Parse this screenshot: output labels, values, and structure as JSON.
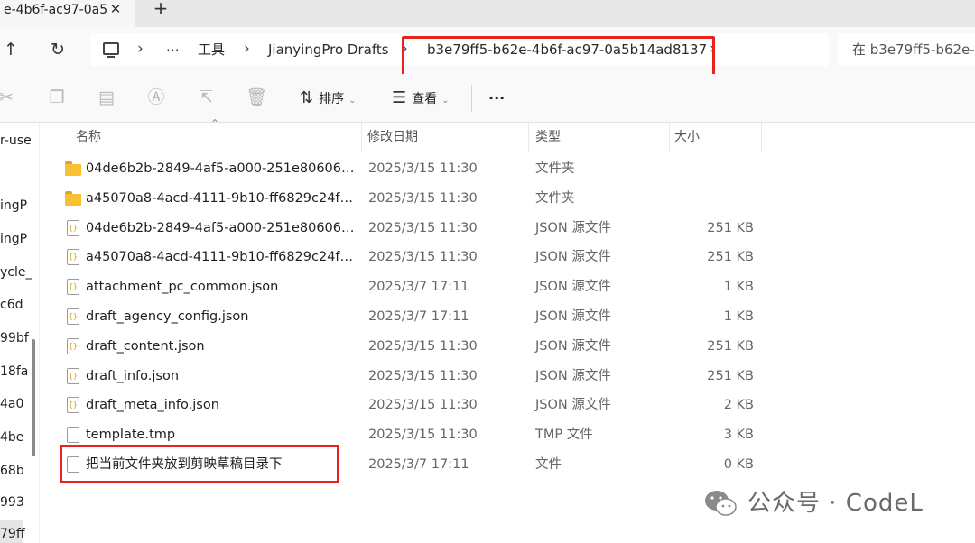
{
  "tab": {
    "title": "e-4b6f-ac97-0a5",
    "close": "✕",
    "new": "+"
  },
  "address": {
    "crumbs": [
      "工具",
      "JianyingPro Drafts",
      "b3e79ff5-b62e-4b6f-ac97-0a5b14ad8137"
    ],
    "overflow": "⋯",
    "search_placeholder": "在 b3e79ff5-b62e-4b6f-ac97-0a5b14ad8137 中搜索"
  },
  "toolbar": {
    "sort_label": "排序",
    "view_label": "查看",
    "more": "···"
  },
  "sidebar": {
    "items": [
      "r-use",
      "ingP",
      "ingP",
      "ycle_",
      "c6d",
      "99bf",
      "18fa",
      "4a0",
      "4be",
      "68b",
      "993",
      "79ff"
    ]
  },
  "columns": {
    "name": "名称",
    "date": "修改日期",
    "type": "类型",
    "size": "大小"
  },
  "files": [
    {
      "kind": "folder",
      "name": "04de6b2b-2849-4af5-a000-251e80606e6c",
      "date": "2025/3/15 11:30",
      "type": "文件夹",
      "size": ""
    },
    {
      "kind": "folder",
      "name": "a45070a8-4acd-4111-9b10-ff6829c24f4b",
      "date": "2025/3/15 11:30",
      "type": "文件夹",
      "size": ""
    },
    {
      "kind": "json",
      "name": "04de6b2b-2849-4af5-a000-251e80606e6c...",
      "date": "2025/3/15 11:30",
      "type": "JSON 源文件",
      "size": "251 KB"
    },
    {
      "kind": "json",
      "name": "a45070a8-4acd-4111-9b10-ff6829c24f4b.j...",
      "date": "2025/3/15 11:30",
      "type": "JSON 源文件",
      "size": "251 KB"
    },
    {
      "kind": "json",
      "name": "attachment_pc_common.json",
      "date": "2025/3/7 17:11",
      "type": "JSON 源文件",
      "size": "1 KB"
    },
    {
      "kind": "json",
      "name": "draft_agency_config.json",
      "date": "2025/3/7 17:11",
      "type": "JSON 源文件",
      "size": "1 KB"
    },
    {
      "kind": "json",
      "name": "draft_content.json",
      "date": "2025/3/15 11:30",
      "type": "JSON 源文件",
      "size": "251 KB"
    },
    {
      "kind": "json",
      "name": "draft_info.json",
      "date": "2025/3/15 11:30",
      "type": "JSON 源文件",
      "size": "251 KB"
    },
    {
      "kind": "json",
      "name": "draft_meta_info.json",
      "date": "2025/3/15 11:30",
      "type": "JSON 源文件",
      "size": "2 KB"
    },
    {
      "kind": "file",
      "name": "template.tmp",
      "date": "2025/3/15 11:30",
      "type": "TMP 文件",
      "size": "3 KB"
    },
    {
      "kind": "file",
      "name": "把当前文件夹放到剪映草稿目录下",
      "date": "2025/3/7 17:11",
      "type": "文件",
      "size": "0 KB"
    }
  ],
  "watermark": {
    "text": "公众号 · CodeL"
  },
  "colors": {
    "highlight": "#e8231d",
    "folder": "#f7c232",
    "wechat_logo": "#8a8a8a"
  }
}
